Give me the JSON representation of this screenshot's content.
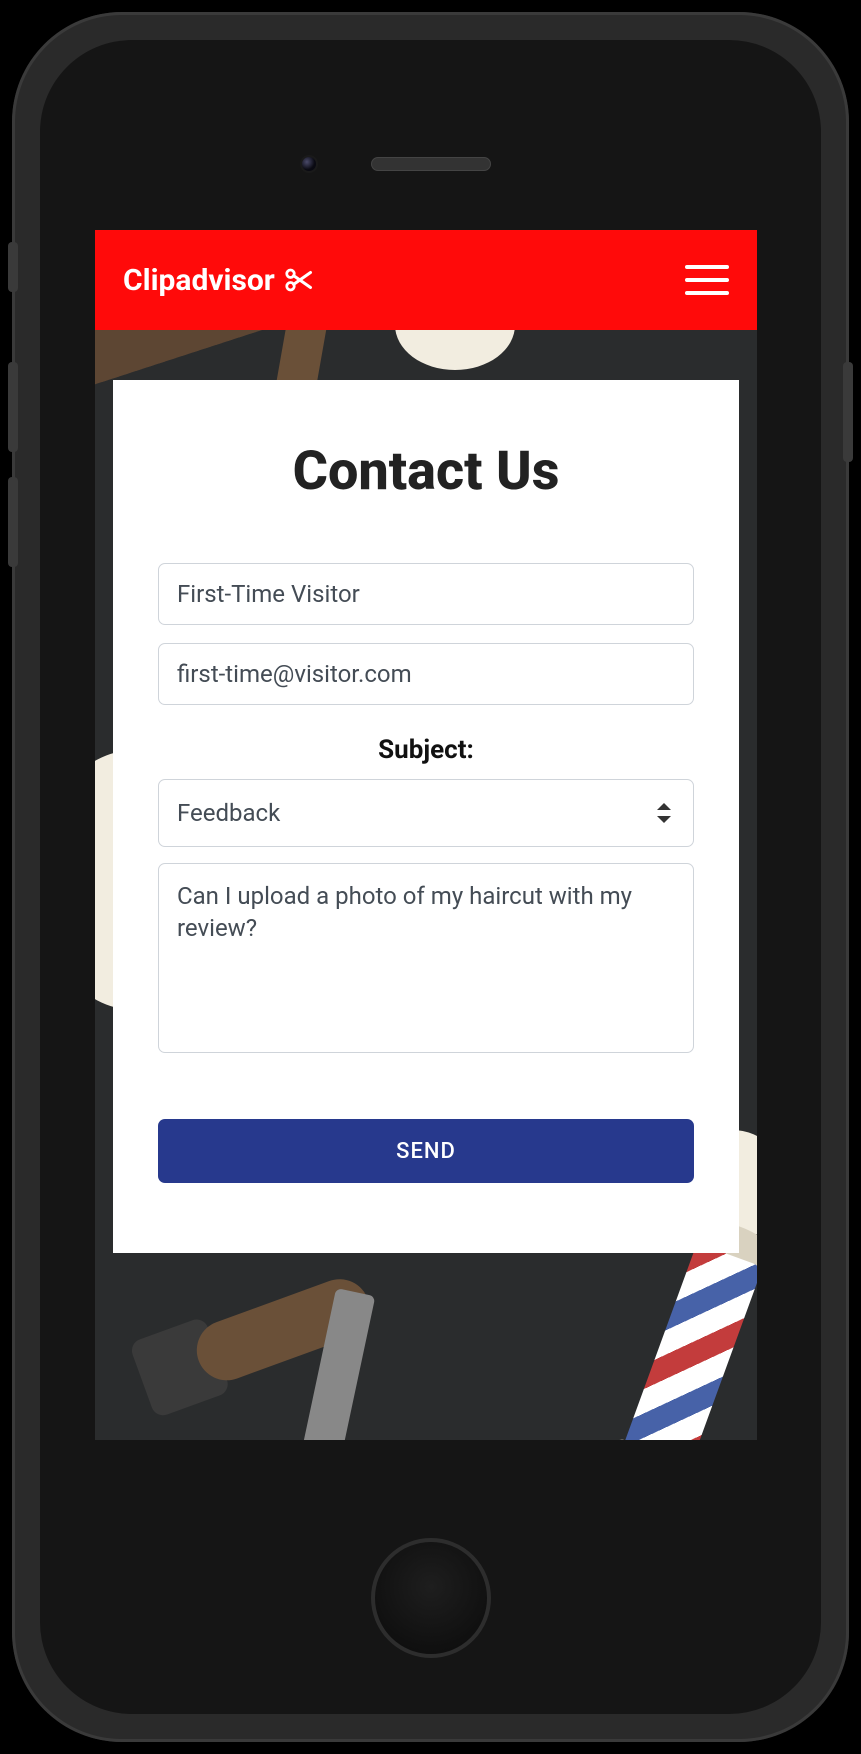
{
  "header": {
    "brand": "Clipadvisor"
  },
  "page": {
    "title": "Contact Us"
  },
  "form": {
    "name_value": "First-Time Visitor",
    "email_value": "first-time@visitor.com",
    "subject_label": "Subject:",
    "subject_selected": "Feedback",
    "message_value": "Can I upload a photo of my haircut with my review?",
    "submit_label": "SEND"
  }
}
